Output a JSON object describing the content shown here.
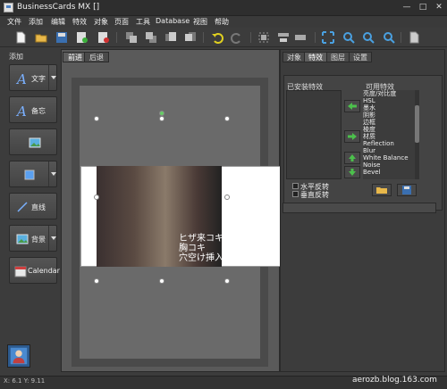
{
  "window": {
    "title": "BusinessCards MX []"
  },
  "menu": [
    "文件",
    "添加",
    "编辑",
    "特效",
    "对象",
    "页面",
    "工具",
    "Database",
    "视图",
    "帮助"
  ],
  "left_panel": {
    "title": "添加",
    "buttons": [
      {
        "label": "文字",
        "icon": "text-icon"
      },
      {
        "label": "备忘",
        "icon": "memo-icon"
      },
      {
        "label": "",
        "icon": "image-icon"
      },
      {
        "label": "",
        "icon": "shape-icon"
      },
      {
        "label": "直线",
        "icon": "line-icon"
      },
      {
        "label": "背景",
        "icon": "background-icon"
      },
      {
        "label": "Calendar",
        "icon": "calendar-icon"
      }
    ]
  },
  "canvas": {
    "tabs": [
      "前进",
      "后退"
    ],
    "active_tab": "前进"
  },
  "right_panel": {
    "tabs": [
      "对象",
      "特效",
      "图层",
      "设置"
    ],
    "active_tab": "特效",
    "installed_label": "已安装特效",
    "available_label": "可用特效",
    "available_effects": [
      "亮度/对比度",
      "HSL",
      "墨水",
      "阴影",
      "边框",
      "棱度",
      "材质",
      "Reflection",
      "Blur",
      "White Balance",
      "Noise",
      "Bevel"
    ],
    "flip_horizontal": "水平反转",
    "flip_vertical": "垂直反转"
  },
  "status": {
    "coords": "X: 6.1 Y: 9.11"
  },
  "watermark": "aerozb.blog.163.com",
  "image_text": [
    "ヒザ来コキ",
    "胸コキ",
    "穴空け挿入"
  ]
}
